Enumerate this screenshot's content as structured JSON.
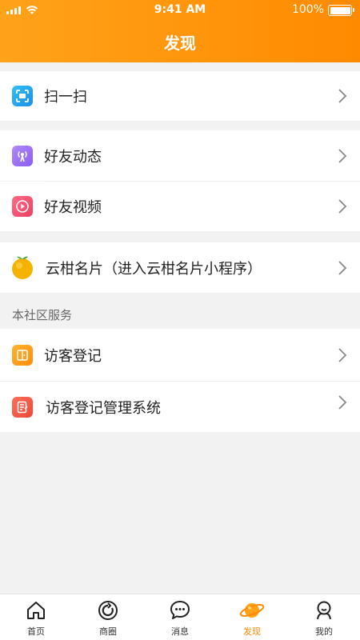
{
  "status": {
    "time": "9:41 AM",
    "battery": "100%"
  },
  "header": {
    "title": "发现"
  },
  "menu": {
    "scan": "扫一扫",
    "friend_moments": "好友动态",
    "friend_videos": "好友视频",
    "yungan_card": "云柑名片（进入云柑名片小程序）",
    "section_label": "本社区服务",
    "visitor_register": "访客登记",
    "visitor_system": "访客登记管理系统"
  },
  "tabs": [
    {
      "label": "首页"
    },
    {
      "label": "商圈"
    },
    {
      "label": "消息"
    },
    {
      "label": "发现"
    },
    {
      "label": "我的"
    }
  ],
  "colors": {
    "accent": "#ff8a00",
    "scan_icon": "#2aa8f0",
    "moments_icon": "#9b6cf5",
    "video_icon": "#f04f6f",
    "visitor_icon": "#ff9a1a",
    "system_icon": "#f25a4a"
  }
}
